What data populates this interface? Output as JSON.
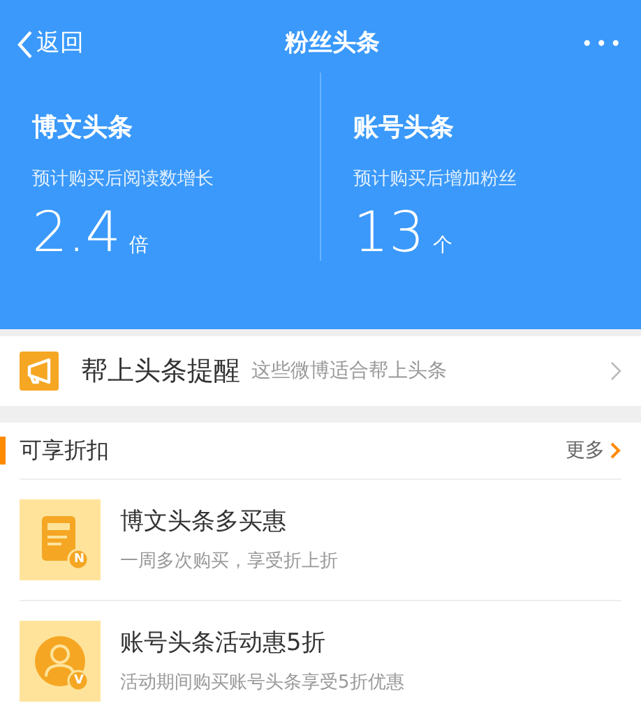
{
  "nav": {
    "back": "返回",
    "title": "粉丝头条",
    "more": "•••"
  },
  "stats": [
    {
      "title": "博文头条",
      "desc": "预计购买后阅读数增长",
      "value": "2.4",
      "unit": "倍"
    },
    {
      "title": "账号头条",
      "desc": "预计购买后增加粉丝",
      "value": "13",
      "unit": "个"
    }
  ],
  "reminder": {
    "title": "帮上头条提醒",
    "subtitle": "这些微博适合帮上头条"
  },
  "section": {
    "title": "可享折扣",
    "more": "更多"
  },
  "offers": [
    {
      "kind": "document",
      "badge": "N",
      "title": "博文头条多买惠",
      "desc": "一周多次购买，享受折上折"
    },
    {
      "kind": "person",
      "badge": "V",
      "title": "账号头条活动惠5折",
      "desc": "活动期间购买账号头条享受5折优惠"
    }
  ]
}
